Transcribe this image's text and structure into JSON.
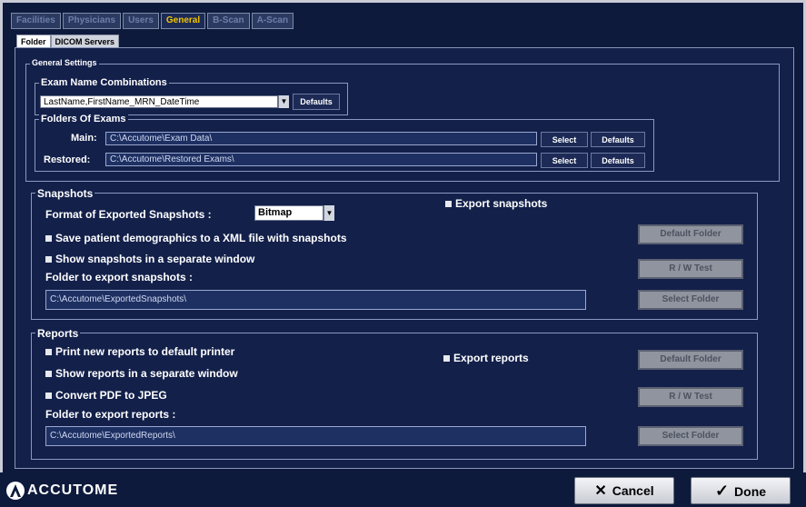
{
  "colors": {
    "background": "#0e1a3c",
    "active_tab_text": "#f2c400",
    "button_grey": "#8f949f"
  },
  "top_tabs": [
    "Facilities",
    "Physicians",
    "Users",
    "General",
    "B-Scan",
    "A-Scan"
  ],
  "sub_tabs": [
    "Folder",
    "DICOM Servers"
  ],
  "general_settings": {
    "title": "General Settings",
    "exam_name": {
      "title": "Exam Name Combinations",
      "value": "LastName,FirstName_MRN_DateTime",
      "defaults_label": "Defaults"
    },
    "folders": {
      "title": "Folders Of Exams",
      "main_label": "Main:",
      "main_value": "C:\\Accutome\\Exam Data\\",
      "restored_label": "Restored:",
      "restored_value": "C:\\Accutome\\Restored Exams\\",
      "select_label": "Select",
      "defaults_label": "Defaults"
    }
  },
  "snapshots": {
    "title": "Snapshots",
    "format_label": "Format of Exported Snapshots :",
    "format_value": "Bitmap",
    "export_label": "Export snapshots",
    "save_demographics_label": "Save patient demographics to a XML file with snapshots",
    "separate_window_label": "Show snapshots in a separate window",
    "folder_label": "Folder to export snapshots :",
    "folder_value": "C:\\Accutome\\ExportedSnapshots\\",
    "default_folder_label": "Default Folder",
    "rw_test_label": "R / W Test",
    "select_folder_label": "Select Folder"
  },
  "reports": {
    "title": "Reports",
    "print_label": "Print new reports to default printer",
    "separate_window_label": "Show reports in a separate window",
    "convert_label": "Convert PDF to JPEG",
    "export_label": "Export reports",
    "folder_label": "Folder to export reports :",
    "folder_value": "C:\\Accutome\\ExportedReports\\",
    "default_folder_label": "Default Folder",
    "rw_test_label": "R / W Test",
    "select_folder_label": "Select Folder"
  },
  "footer": {
    "logo_text": "ACCUTOME",
    "cancel_icon": "x-icon",
    "cancel_label": "Cancel",
    "done_icon": "check-icon",
    "done_label": "Done"
  }
}
